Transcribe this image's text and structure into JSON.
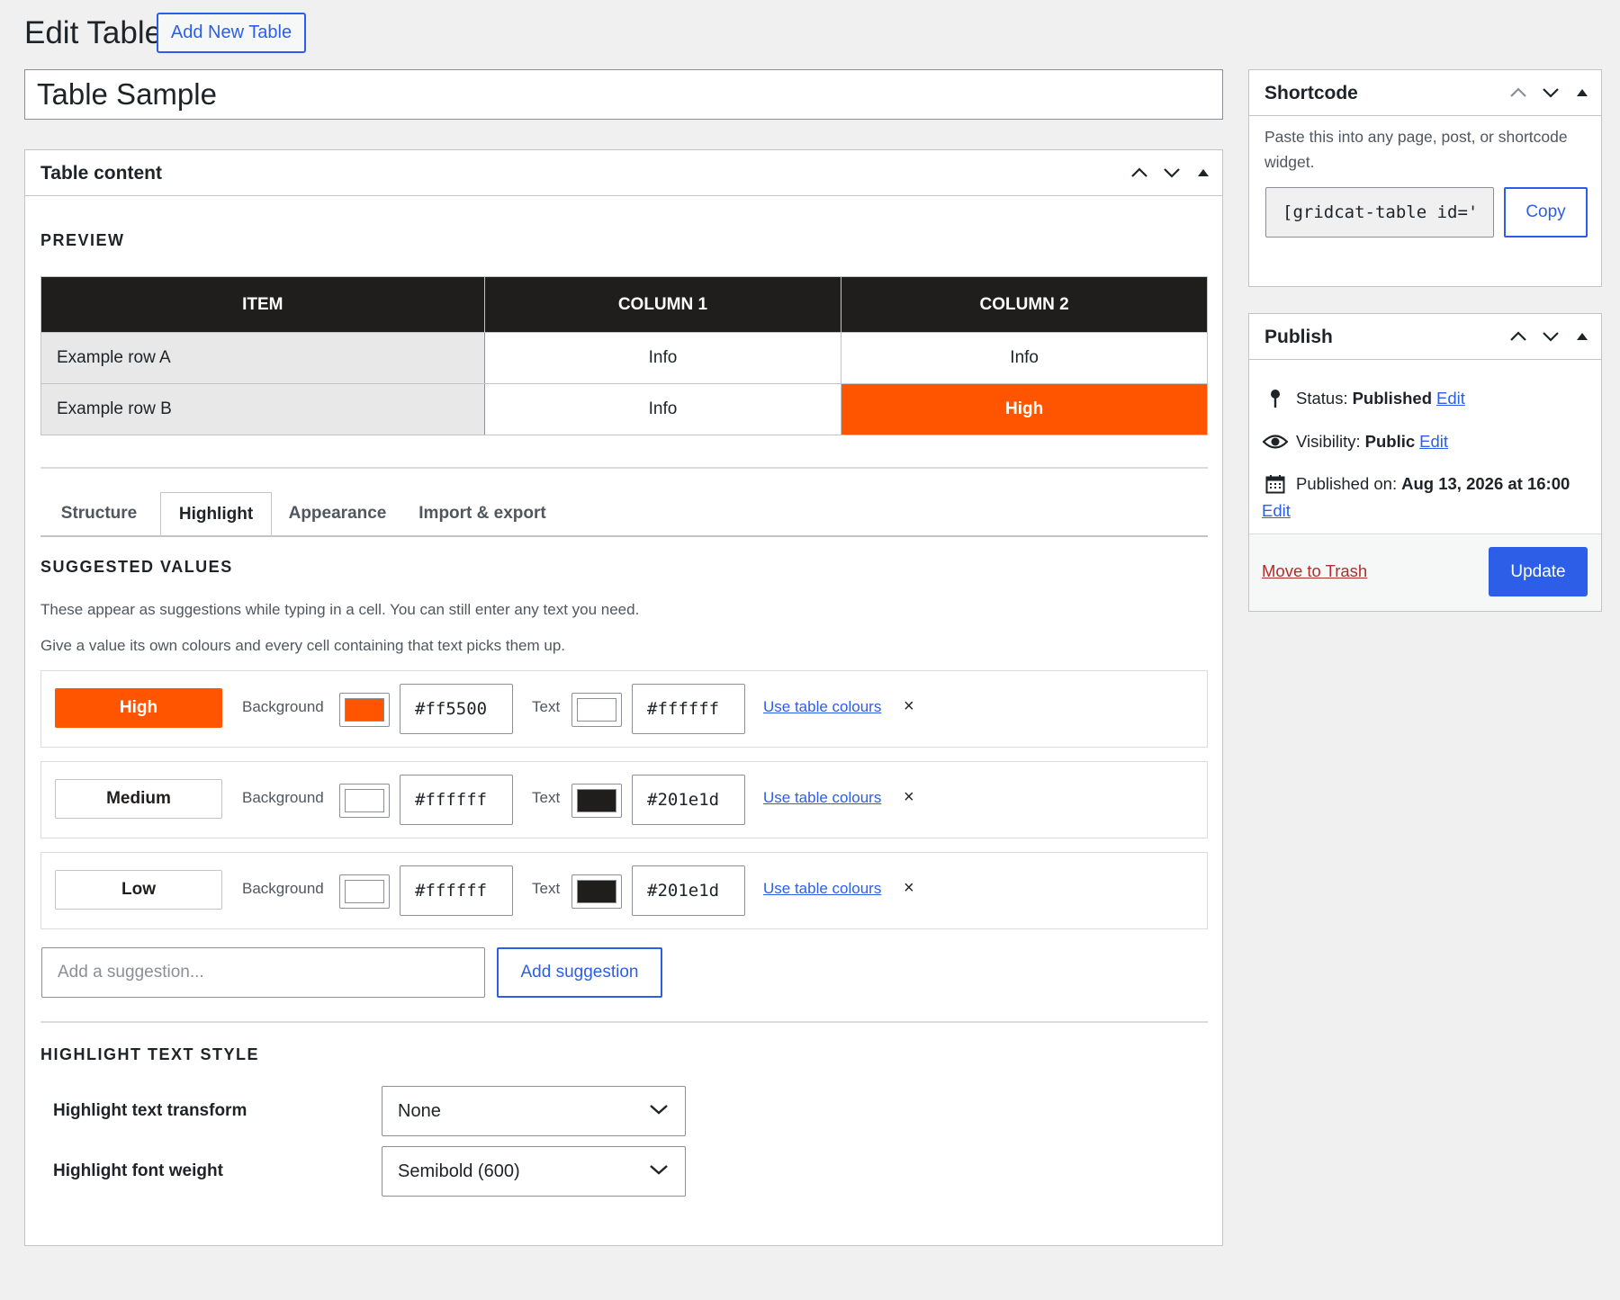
{
  "header": {
    "page_title": "Edit Table",
    "add_new_label": "Add New Table"
  },
  "post_title": "Table Sample",
  "table_content": {
    "box_title": "Table content",
    "preview_heading": "PREVIEW",
    "preview": {
      "headers": [
        "ITEM",
        "COLUMN 1",
        "COLUMN 2"
      ],
      "rows": [
        [
          "Example row A",
          "Info",
          "Info"
        ],
        [
          "Example row B",
          "Info",
          "High"
        ]
      ]
    },
    "tabs": [
      {
        "label": "Structure",
        "active": false
      },
      {
        "label": "Highlight",
        "active": true
      },
      {
        "label": "Appearance",
        "active": false
      },
      {
        "label": "Import & export",
        "active": false
      }
    ],
    "suggested_heading": "SUGGESTED VALUES",
    "desc1": "These appear as suggestions while typing in a cell. You can still enter any text you need.",
    "desc2": "Give a value its own colours and every cell containing that text picks them up.",
    "background_label": "Background",
    "text_label": "Text",
    "use_table_colours": "Use table colours",
    "remove_glyph": "×",
    "suggestions": [
      {
        "value": "High",
        "background": "#ff5500",
        "text": "#ffffff"
      },
      {
        "value": "Medium",
        "background": "#ffffff",
        "text": "#201e1d"
      },
      {
        "value": "Low",
        "background": "#ffffff",
        "text": "#201e1d"
      }
    ],
    "add_placeholder": "Add a suggestion...",
    "add_button": "Add suggestion",
    "style_heading": "HIGHLIGHT TEXT STYLE",
    "transform_label": "Highlight text transform",
    "transform_value": "None",
    "weight_label": "Highlight font weight",
    "weight_value": "Semibold (600)"
  },
  "shortcode": {
    "title": "Shortcode",
    "help": "Paste this into any page, post, or shortcode widget.",
    "value": "[gridcat-table id='",
    "copy_label": "Copy"
  },
  "publish": {
    "title": "Publish",
    "status_label": "Status:",
    "status_value": "Published",
    "visibility_label": "Visibility:",
    "visibility_value": "Public",
    "published_label": "Published on:",
    "published_value": "Aug 13, 2026 at 16:00",
    "edit_label": "Edit",
    "trash_label": "Move to Trash",
    "update_label": "Update"
  },
  "colors": {
    "accent": "#2c5ee8",
    "highlight": "#ff5500",
    "header_dark": "#201e1d",
    "danger": "#b32d2e"
  },
  "icons": [
    "chevron-up-icon",
    "chevron-down-icon",
    "triangle-up-icon",
    "pin-icon",
    "eye-icon",
    "calendar-icon",
    "chevron-down-icon"
  ]
}
